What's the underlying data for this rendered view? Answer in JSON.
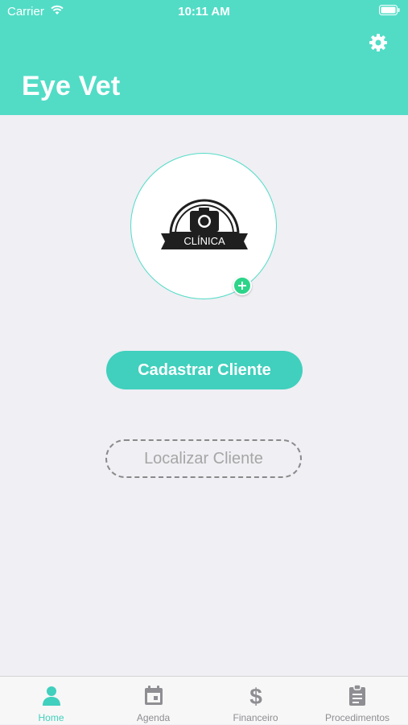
{
  "status_bar": {
    "carrier": "Carrier",
    "time": "10:11 AM"
  },
  "header": {
    "title": "Eye Vet",
    "settings_icon": "gear-icon"
  },
  "profile": {
    "logo_text": "CLÍNICA",
    "add_icon": "plus-icon"
  },
  "actions": {
    "primary_label": "Cadastrar Cliente",
    "secondary_label": "Localizar Cliente"
  },
  "tabbar": {
    "items": [
      {
        "label": "Home",
        "icon": "person-icon",
        "active": true
      },
      {
        "label": "Agenda",
        "icon": "calendar-icon",
        "active": false
      },
      {
        "label": "Financeiro",
        "icon": "dollar-icon",
        "active": false
      },
      {
        "label": "Procedimentos",
        "icon": "clipboard-icon",
        "active": false
      }
    ]
  },
  "colors": {
    "accent": "#52dcc6",
    "button": "#40d0bd",
    "add_badge": "#2dd48a",
    "background": "#efeff4"
  }
}
